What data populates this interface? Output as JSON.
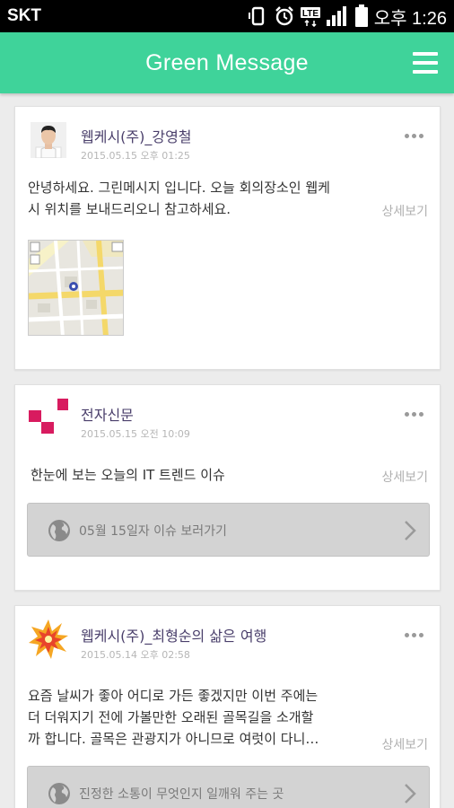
{
  "status_bar": {
    "carrier": "SKT",
    "network_badge": "LTE",
    "time": "오후 1:26",
    "icons": [
      "vibrate-icon",
      "alarm-icon",
      "lte-icon",
      "signal-icon",
      "battery-icon"
    ]
  },
  "app_bar": {
    "title": "Green Message",
    "menu_icon": "hamburger-menu-icon"
  },
  "colors": {
    "brand_green": "#3fd39a",
    "author_text": "#4a3f6b",
    "muted_text": "#b0b0b0",
    "logo_pink": "#d81b5f"
  },
  "feed": {
    "detail_label": "상세보기",
    "posts": [
      {
        "author": "웹케시(주)_강영철",
        "date": "2015.05.15 오후 01:25",
        "lines": [
          "안녕하세요. 그린메시지 입니다. 오늘 회의장소인 웹케",
          "시 위치를 보내드리오니 참고하세요."
        ],
        "attachment": "map-thumbnail"
      },
      {
        "author": "전자신문",
        "date": "2015.05.15 오전 10:09",
        "lines": [
          "한눈에 보는 오늘의 IT 트렌드 이슈"
        ],
        "link_label": "05월 15일자 이슈 보러가기"
      },
      {
        "author": "웹케시(주)_최형순의 삶은 여행",
        "date": "2015.05.14 오후 02:58",
        "lines": [
          "요즘 날씨가 좋아 어디로 가든 좋겠지만 이번 주에는",
          "더 더워지기 전에 가볼만한  오래된 골목길을 소개할",
          "까 합니다.  골목은 관광지가 아니므로 여럿이 다니…"
        ],
        "link_label": "진정한 소통이 무엇인지 일깨워 주는 곳"
      }
    ]
  }
}
